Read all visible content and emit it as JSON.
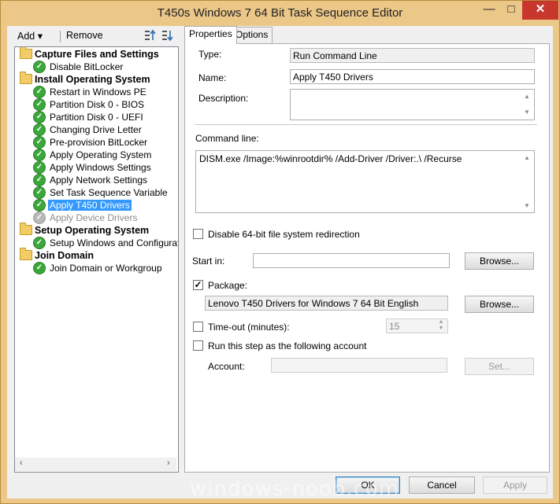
{
  "window": {
    "title": "T450s Windows 7 64 Bit Task Sequence Editor",
    "minimize": "—",
    "maximize": "□",
    "close": "✕"
  },
  "toolbar": {
    "add_label": "Add",
    "add_arrow": "▾",
    "remove_label": "Remove"
  },
  "tree": {
    "groups": [
      {
        "label": "Capture Files and Settings",
        "items": [
          "Disable BitLocker"
        ]
      },
      {
        "label": "Install Operating System",
        "items": [
          "Restart in Windows PE",
          "Partition Disk 0 - BIOS",
          "Partition Disk 0 - UEFI",
          "Changing Drive Letter",
          "Pre-provision BitLocker",
          "Apply Operating System",
          "Apply Windows Settings",
          "Apply Network Settings",
          "Set Task Sequence Variable",
          "Apply T450 Drivers",
          "Apply Device Drivers"
        ]
      },
      {
        "label": "Setup Operating System",
        "items": [
          "Setup Windows and Configuration"
        ]
      },
      {
        "label": "Join Domain",
        "items": [
          "Join Domain or Workgroup"
        ]
      }
    ],
    "selected": "Apply T450 Drivers",
    "disabled": "Apply Device Drivers",
    "scroll_left": "‹",
    "scroll_right": "›"
  },
  "tabs": [
    "Properties",
    "Options"
  ],
  "properties": {
    "type_label": "Type:",
    "type_value": "Run Command Line",
    "name_label": "Name:",
    "name_value": "Apply T450 Drivers",
    "description_label": "Description:",
    "description_value": "",
    "command_line_label": "Command line:",
    "command_line_value": "DISM.exe /Image:%winrootdir% /Add-Driver /Driver:.\\ /Recurse",
    "disable64_label": "Disable 64-bit file system redirection",
    "disable64_checked": false,
    "start_in_label": "Start in:",
    "start_in_value": "",
    "browse_label": "Browse...",
    "package_label": "Package:",
    "package_checked": true,
    "package_value": "Lenovo T450 Drivers for Windows 7 64 Bit  English",
    "timeout_label": "Time-out (minutes):",
    "timeout_checked": false,
    "timeout_value": "15",
    "run_as_label": "Run this step as the following account",
    "run_as_checked": false,
    "account_label": "Account:",
    "account_value": "",
    "set_label": "Set..."
  },
  "buttons": {
    "ok": "OK",
    "cancel": "Cancel",
    "apply": "Apply"
  },
  "checkmark": "✓",
  "watermark": "windows-noob.com",
  "colors": {
    "titlebar": "#ebc788",
    "selection": "#3399ff",
    "close": "#c7372e",
    "success": "#3aa83a"
  }
}
